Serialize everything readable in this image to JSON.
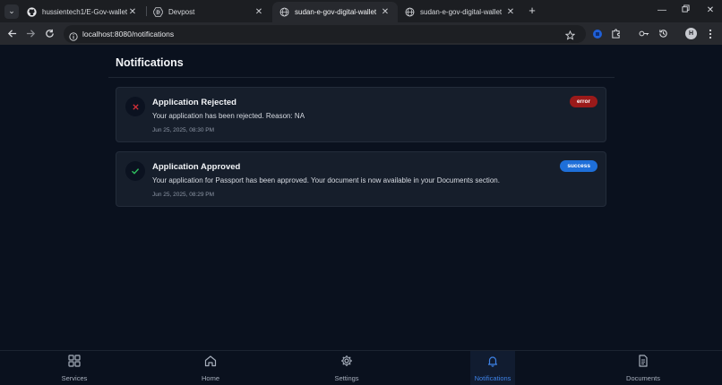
{
  "browser": {
    "tabs": [
      {
        "label": "hussientech1/E-Gov-wallet",
        "icon": "github-icon"
      },
      {
        "label": "Devpost",
        "icon": "devpost-icon"
      },
      {
        "label": "sudan-e-gov-digital-wallet",
        "icon": "globe-icon",
        "active": true
      },
      {
        "label": "sudan-e-gov-digital-wallet",
        "icon": "globe-icon"
      }
    ],
    "url": "localhost:8080/notifications",
    "profile_initial": "H"
  },
  "page": {
    "title": "Notifications",
    "notifications": [
      {
        "title": "Application Rejected",
        "message": "Your application has been rejected. Reason: NA",
        "date": "Jun 25, 2025, 08:30 PM",
        "badge": "error",
        "icon": "x-icon",
        "badge_color": "#9b1a1a"
      },
      {
        "title": "Application Approved",
        "message": "Your application for Passport has been approved. Your document is now available in your Documents section.",
        "date": "Jun 25, 2025, 08:29 PM",
        "badge": "success",
        "icon": "check-icon",
        "badge_color": "#1e6fd9"
      }
    ]
  },
  "nav": {
    "items": [
      {
        "label": "Services",
        "icon": "grid-icon"
      },
      {
        "label": "Home",
        "icon": "home-icon"
      },
      {
        "label": "Settings",
        "icon": "gear-icon"
      },
      {
        "label": "Notifications",
        "icon": "bell-icon",
        "active": true
      },
      {
        "label": "Documents",
        "icon": "document-icon"
      }
    ]
  },
  "colors": {
    "accent": "#3e82e6",
    "background": "#0a111e",
    "card": "#161e2b"
  }
}
